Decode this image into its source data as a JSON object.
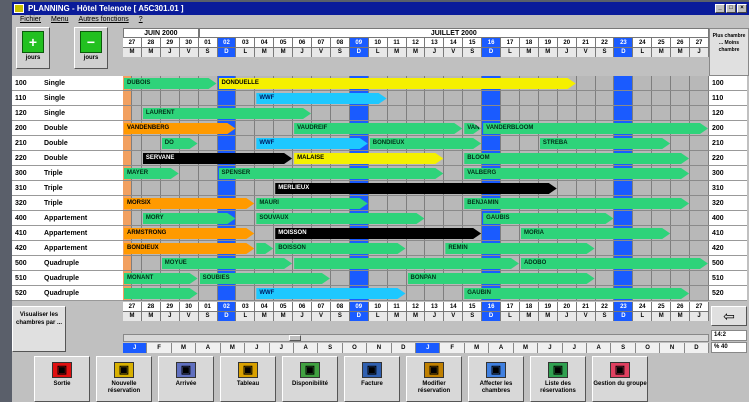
{
  "title": "PLANNING - Hôtel Telenote [ A5C301.01 ]",
  "menu": [
    "Fichier",
    "Menu",
    "Autres fonctions",
    "?"
  ],
  "toolbar": {
    "add_label": "jours",
    "remove_label": "jours",
    "add_icon": "plus-icon",
    "remove_icon": "minus-icon"
  },
  "months": [
    {
      "label": "JUIN 2000",
      "start": 0,
      "span": 4
    },
    {
      "label": "JUILLET 2000",
      "start": 4,
      "span": 27
    }
  ],
  "days": [
    {
      "n": "27",
      "d": "M"
    },
    {
      "n": "28",
      "d": "M"
    },
    {
      "n": "29",
      "d": "J"
    },
    {
      "n": "30",
      "d": "V"
    },
    {
      "n": "01",
      "d": "S"
    },
    {
      "n": "02",
      "d": "D",
      "w": true
    },
    {
      "n": "03",
      "d": "L"
    },
    {
      "n": "04",
      "d": "M"
    },
    {
      "n": "05",
      "d": "M"
    },
    {
      "n": "06",
      "d": "J"
    },
    {
      "n": "07",
      "d": "V"
    },
    {
      "n": "08",
      "d": "S"
    },
    {
      "n": "09",
      "d": "D",
      "w": true
    },
    {
      "n": "10",
      "d": "L"
    },
    {
      "n": "11",
      "d": "M"
    },
    {
      "n": "12",
      "d": "M"
    },
    {
      "n": "13",
      "d": "J"
    },
    {
      "n": "14",
      "d": "V"
    },
    {
      "n": "15",
      "d": "S"
    },
    {
      "n": "16",
      "d": "D",
      "w": true
    },
    {
      "n": "17",
      "d": "L"
    },
    {
      "n": "18",
      "d": "M"
    },
    {
      "n": "19",
      "d": "M"
    },
    {
      "n": "20",
      "d": "J"
    },
    {
      "n": "21",
      "d": "V"
    },
    {
      "n": "22",
      "d": "S"
    },
    {
      "n": "23",
      "d": "D",
      "w": true
    },
    {
      "n": "24",
      "d": "L"
    },
    {
      "n": "25",
      "d": "M"
    },
    {
      "n": "26",
      "d": "M"
    },
    {
      "n": "27",
      "d": "J"
    }
  ],
  "rooms": [
    {
      "num": "100",
      "type": "Single"
    },
    {
      "num": "110",
      "type": "Single"
    },
    {
      "num": "120",
      "type": "Single"
    },
    {
      "num": "200",
      "type": "Double"
    },
    {
      "num": "210",
      "type": "Double"
    },
    {
      "num": "220",
      "type": "Double"
    },
    {
      "num": "300",
      "type": "Triple"
    },
    {
      "num": "310",
      "type": "Triple"
    },
    {
      "num": "320",
      "type": "Triple"
    },
    {
      "num": "400",
      "type": "Appartement"
    },
    {
      "num": "410",
      "type": "Appartement"
    },
    {
      "num": "420",
      "type": "Appartement"
    },
    {
      "num": "500",
      "type": "Quadruple"
    },
    {
      "num": "510",
      "type": "Quadruple"
    },
    {
      "num": "520",
      "type": "Quadruple"
    }
  ],
  "bookings": [
    {
      "row": 0,
      "start": 0,
      "end": 5,
      "c": "g",
      "label": "DUBOIS"
    },
    {
      "row": 0,
      "start": 5,
      "end": 24,
      "c": "y",
      "label": "DONDUELLE"
    },
    {
      "row": 1,
      "start": 7,
      "end": 14,
      "c": "b",
      "label": "WWF"
    },
    {
      "row": 2,
      "start": 1,
      "end": 10,
      "c": "g",
      "label": "LAURENT"
    },
    {
      "row": 3,
      "start": 0,
      "end": 6,
      "c": "o",
      "label": "VANDENBERG"
    },
    {
      "row": 3,
      "start": 9,
      "end": 18,
      "c": "g",
      "label": "VAUDREIF"
    },
    {
      "row": 3,
      "start": 18,
      "end": 19,
      "c": "g",
      "label": "VAN"
    },
    {
      "row": 3,
      "start": 19,
      "end": 31,
      "c": "g",
      "label": "VANDERBLOOM"
    },
    {
      "row": 4,
      "start": 2,
      "end": 4,
      "c": "g",
      "label": "DO"
    },
    {
      "row": 4,
      "start": 7,
      "end": 13,
      "c": "b",
      "label": "WWF"
    },
    {
      "row": 4,
      "start": 13,
      "end": 19,
      "c": "g",
      "label": "BONDIEUX"
    },
    {
      "row": 4,
      "start": 22,
      "end": 29,
      "c": "g",
      "label": "STREBA"
    },
    {
      "row": 5,
      "start": 1,
      "end": 9,
      "c": "k",
      "label": "SERVANE"
    },
    {
      "row": 5,
      "start": 9,
      "end": 17,
      "c": "y",
      "label": "MALAISE"
    },
    {
      "row": 5,
      "start": 18,
      "end": 30,
      "c": "g",
      "label": "BLOOM"
    },
    {
      "row": 6,
      "start": 0,
      "end": 3,
      "c": "g",
      "label": "MAYER"
    },
    {
      "row": 6,
      "start": 5,
      "end": 17,
      "c": "g",
      "label": "SPENSER"
    },
    {
      "row": 6,
      "start": 18,
      "end": 30,
      "c": "g",
      "label": "VALBERG"
    },
    {
      "row": 7,
      "start": 8,
      "end": 23,
      "c": "k",
      "label": "MERLIEUX"
    },
    {
      "row": 8,
      "start": 0,
      "end": 7,
      "c": "o",
      "label": "MORSIX"
    },
    {
      "row": 8,
      "start": 7,
      "end": 13,
      "c": "g",
      "label": "MAURI"
    },
    {
      "row": 8,
      "start": 18,
      "end": 30,
      "c": "g",
      "label": "BENJAMIN"
    },
    {
      "row": 9,
      "start": 1,
      "end": 6,
      "c": "g",
      "label": "MORY"
    },
    {
      "row": 9,
      "start": 7,
      "end": 16,
      "c": "g",
      "label": "SOUVAUX"
    },
    {
      "row": 9,
      "start": 19,
      "end": 26,
      "c": "g",
      "label": "GAUBIS"
    },
    {
      "row": 10,
      "start": 0,
      "end": 7,
      "c": "o",
      "label": "ARMSTRONG"
    },
    {
      "row": 10,
      "start": 8,
      "end": 19,
      "c": "k",
      "label": "MOISSON"
    },
    {
      "row": 10,
      "start": 21,
      "end": 29,
      "c": "g",
      "label": "MORIA"
    },
    {
      "row": 11,
      "start": 0,
      "end": 7,
      "c": "o",
      "label": "BONDIEUX"
    },
    {
      "row": 11,
      "start": 7,
      "end": 8,
      "c": "g",
      "label": ""
    },
    {
      "row": 11,
      "start": 8,
      "end": 15,
      "c": "g",
      "label": "BOISSON"
    },
    {
      "row": 11,
      "start": 17,
      "end": 25,
      "c": "g",
      "label": "REMIN"
    },
    {
      "row": 12,
      "start": 2,
      "end": 9,
      "c": "g",
      "label": "MOYUE"
    },
    {
      "row": 12,
      "start": 9,
      "end": 21,
      "c": "g",
      "label": ""
    },
    {
      "row": 12,
      "start": 21,
      "end": 31,
      "c": "g",
      "label": "ADOBO"
    },
    {
      "row": 13,
      "start": 0,
      "end": 4,
      "c": "g",
      "label": "MONANT"
    },
    {
      "row": 13,
      "start": 4,
      "end": 11,
      "c": "g",
      "label": "SOUBIES"
    },
    {
      "row": 13,
      "start": 15,
      "end": 25,
      "c": "g",
      "label": "BONPAN"
    },
    {
      "row": 14,
      "start": 0,
      "end": 4,
      "c": "g",
      "label": ""
    },
    {
      "row": 14,
      "start": 7,
      "end": 15,
      "c": "b",
      "label": "WWF"
    },
    {
      "row": 14,
      "start": 18,
      "end": 30,
      "c": "g",
      "label": "GAUBIN"
    }
  ],
  "visualize_label": "Visualiser les chambres par ...",
  "right_top": "Plus chambre ... Moins chambre",
  "month_strip": [
    "J",
    "F",
    "M",
    "A",
    "M",
    "J",
    "J",
    "A",
    "S",
    "O",
    "N",
    "D",
    "J",
    "F",
    "M",
    "A",
    "M",
    "J",
    "J",
    "A",
    "S",
    "O",
    "N",
    "D"
  ],
  "zoom": "14:2",
  "percent": "% 40",
  "bottom_buttons": [
    {
      "label": "Sortie",
      "icon": "exit-icon",
      "color": "#e01010"
    },
    {
      "label": "Nouvelle réservation",
      "icon": "new-booking-icon",
      "color": "#d8b000"
    },
    {
      "label": "Arrivée",
      "icon": "arrival-icon",
      "color": "#6070c0"
    },
    {
      "label": "Tableau",
      "icon": "table-icon",
      "color": "#d8a000"
    },
    {
      "label": "Disponibilité",
      "icon": "availability-icon",
      "color": "#40a040"
    },
    {
      "label": "Facture",
      "icon": "invoice-icon",
      "color": "#3060b0"
    },
    {
      "label": "Modifier réservation",
      "icon": "edit-booking-icon",
      "color": "#c08000"
    },
    {
      "label": "Affecter les chambres",
      "icon": "assign-rooms-icon",
      "color": "#4080e0"
    },
    {
      "label": "Liste des réservations",
      "icon": "booking-list-icon",
      "color": "#30a050"
    },
    {
      "label": "Gestion du groupe",
      "icon": "group-icon",
      "color": "#e04060"
    }
  ]
}
